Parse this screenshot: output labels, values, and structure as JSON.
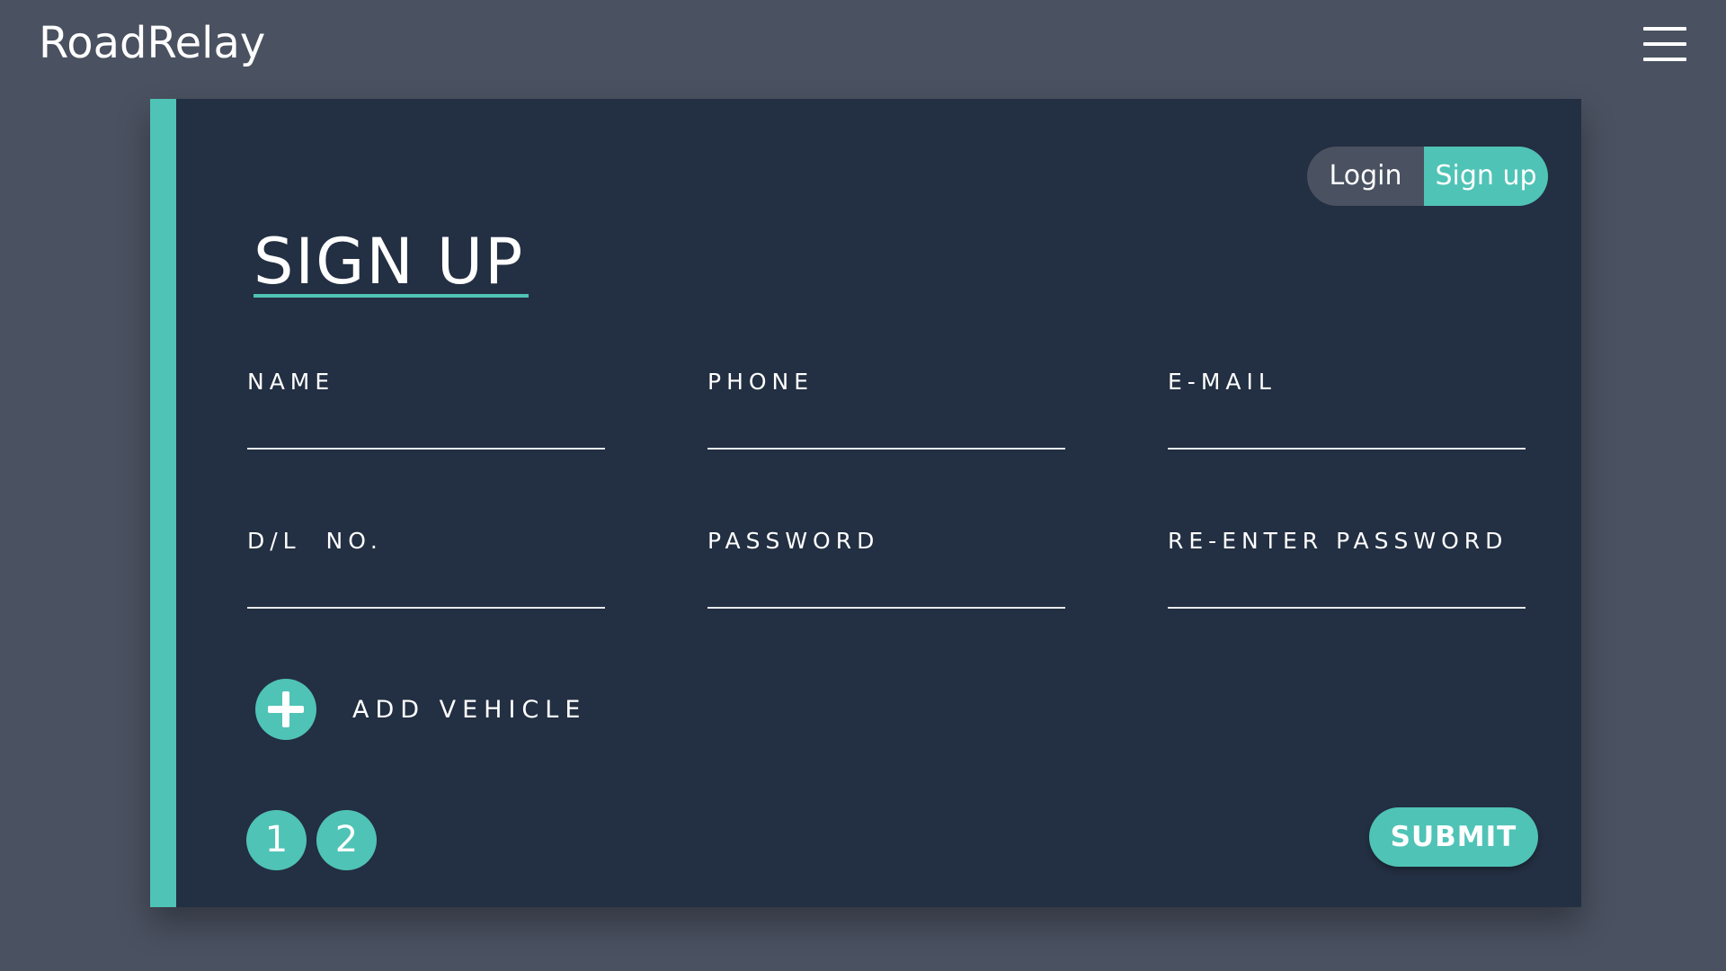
{
  "header": {
    "brand": "RoadRelay",
    "menu_icon": "hamburger-menu-icon"
  },
  "auth_toggle": {
    "login_label": "Login",
    "signup_label": "Sign up",
    "active": "signup"
  },
  "form": {
    "title": "SIGN UP",
    "fields": {
      "name": {
        "label": "NAME",
        "value": ""
      },
      "phone": {
        "label": "PHONE",
        "value": ""
      },
      "email": {
        "label": "E-MAIL",
        "value": ""
      },
      "dl_no": {
        "label": "D/L  NO.",
        "value": ""
      },
      "password": {
        "label": "PASSWORD",
        "value": ""
      },
      "reenter_password": {
        "label": "RE-ENTER PASSWORD",
        "value": ""
      }
    },
    "add_vehicle": {
      "label": "ADD VEHICLE",
      "icon": "plus-icon"
    },
    "steps": [
      "1",
      "2"
    ],
    "submit_label": "SUBMIT"
  },
  "colors": {
    "background": "#4a5160",
    "card": "#232f42",
    "accent": "#4fc3b6",
    "text": "#ffffff"
  }
}
